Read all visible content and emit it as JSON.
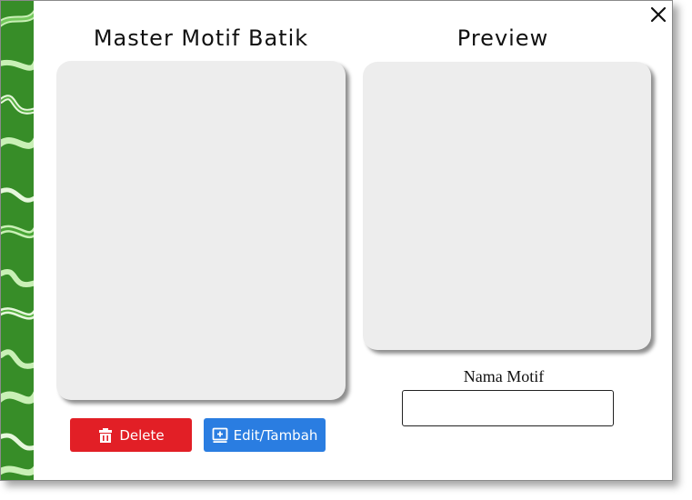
{
  "window": {
    "title_master": "Master Motif Batik",
    "title_preview": "Preview",
    "close_icon": "close-icon"
  },
  "buttons": {
    "delete_label": "Delete",
    "delete_icon": "trash-icon",
    "edit_label": "Edit/Tambah",
    "edit_icon": "add-box-icon"
  },
  "form": {
    "name_label": "Nama Motif",
    "name_value": ""
  },
  "colors": {
    "delete": "#e21f26",
    "edit": "#2a7de1",
    "panel": "#ededed",
    "batik_green": "#3f9a2e"
  }
}
